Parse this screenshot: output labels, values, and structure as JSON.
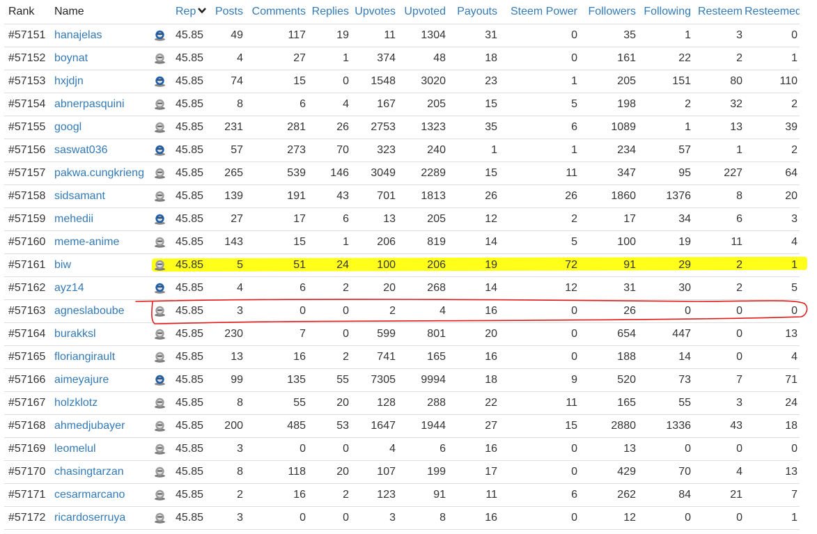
{
  "table": {
    "columns": [
      "Rank",
      "Name",
      "Rep",
      "Posts",
      "Comments",
      "Replies",
      "Upvotes",
      "Upvoted",
      "Payouts",
      "Steem Power",
      "Followers",
      "Following",
      "Resteem",
      "Resteemed"
    ],
    "sort_indicator": "chevron-down-icon",
    "rows": [
      {
        "rank": "#57151",
        "name": "hanajelas",
        "avatar": "blue-avatar-icon",
        "rep": "45.85",
        "posts": "49",
        "comments": "117",
        "replies": "19",
        "upvotes": "11",
        "upvoted": "1304",
        "payouts": "31",
        "steem_power": "0",
        "followers": "35",
        "following": "1",
        "resteem": "3",
        "resteemed": "0"
      },
      {
        "rank": "#57152",
        "name": "boynat",
        "avatar": "gray-avatar-icon",
        "rep": "45.85",
        "posts": "4",
        "comments": "27",
        "replies": "1",
        "upvotes": "374",
        "upvoted": "48",
        "payouts": "18",
        "steem_power": "0",
        "followers": "161",
        "following": "22",
        "resteem": "2",
        "resteemed": "1"
      },
      {
        "rank": "#57153",
        "name": "hxjdjn",
        "avatar": "blue-avatar-icon",
        "rep": "45.85",
        "posts": "74",
        "comments": "15",
        "replies": "0",
        "upvotes": "1548",
        "upvoted": "3020",
        "payouts": "23",
        "steem_power": "1",
        "followers": "205",
        "following": "151",
        "resteem": "80",
        "resteemed": "110"
      },
      {
        "rank": "#57154",
        "name": "abnerpasquini",
        "avatar": "gray-avatar-icon",
        "rep": "45.85",
        "posts": "8",
        "comments": "6",
        "replies": "4",
        "upvotes": "167",
        "upvoted": "205",
        "payouts": "15",
        "steem_power": "5",
        "followers": "198",
        "following": "2",
        "resteem": "32",
        "resteemed": "2"
      },
      {
        "rank": "#57155",
        "name": "googl",
        "avatar": "gray-avatar-icon",
        "rep": "45.85",
        "posts": "231",
        "comments": "281",
        "replies": "26",
        "upvotes": "2753",
        "upvoted": "1323",
        "payouts": "35",
        "steem_power": "6",
        "followers": "1089",
        "following": "1",
        "resteem": "13",
        "resteemed": "39"
      },
      {
        "rank": "#57156",
        "name": "saswat036",
        "avatar": "blue-avatar-icon",
        "rep": "45.85",
        "posts": "57",
        "comments": "273",
        "replies": "70",
        "upvotes": "323",
        "upvoted": "240",
        "payouts": "1",
        "steem_power": "1",
        "followers": "234",
        "following": "57",
        "resteem": "1",
        "resteemed": "2"
      },
      {
        "rank": "#57157",
        "name": "pakwa.cungkrieng",
        "avatar": "gray-avatar-icon",
        "rep": "45.85",
        "posts": "265",
        "comments": "539",
        "replies": "146",
        "upvotes": "3049",
        "upvoted": "2289",
        "payouts": "15",
        "steem_power": "11",
        "followers": "347",
        "following": "95",
        "resteem": "227",
        "resteemed": "64"
      },
      {
        "rank": "#57158",
        "name": "sidsamant",
        "avatar": "gray-avatar-icon",
        "rep": "45.85",
        "posts": "139",
        "comments": "191",
        "replies": "43",
        "upvotes": "701",
        "upvoted": "1813",
        "payouts": "26",
        "steem_power": "26",
        "followers": "1860",
        "following": "1376",
        "resteem": "8",
        "resteemed": "20"
      },
      {
        "rank": "#57159",
        "name": "mehedii",
        "avatar": "blue-avatar-icon",
        "rep": "45.85",
        "posts": "27",
        "comments": "17",
        "replies": "6",
        "upvotes": "13",
        "upvoted": "205",
        "payouts": "12",
        "steem_power": "2",
        "followers": "17",
        "following": "34",
        "resteem": "6",
        "resteemed": "3"
      },
      {
        "rank": "#57160",
        "name": "meme-anime",
        "avatar": "gray-avatar-icon",
        "rep": "45.85",
        "posts": "143",
        "comments": "15",
        "replies": "1",
        "upvotes": "206",
        "upvoted": "819",
        "payouts": "14",
        "steem_power": "5",
        "followers": "100",
        "following": "19",
        "resteem": "11",
        "resteemed": "4"
      },
      {
        "rank": "#57161",
        "name": "biw",
        "avatar": "gray-avatar-icon",
        "rep": "45.85",
        "posts": "5",
        "comments": "51",
        "replies": "24",
        "upvotes": "100",
        "upvoted": "206",
        "payouts": "19",
        "steem_power": "72",
        "followers": "91",
        "following": "29",
        "resteem": "2",
        "resteemed": "1"
      },
      {
        "rank": "#57162",
        "name": "ayz14",
        "avatar": "blue-avatar-icon",
        "rep": "45.85",
        "posts": "4",
        "comments": "6",
        "replies": "2",
        "upvotes": "20",
        "upvoted": "268",
        "payouts": "14",
        "steem_power": "12",
        "followers": "31",
        "following": "30",
        "resteem": "2",
        "resteemed": "5"
      },
      {
        "rank": "#57163",
        "name": "agneslaboube",
        "avatar": "gray-avatar-icon",
        "rep": "45.85",
        "posts": "3",
        "comments": "0",
        "replies": "0",
        "upvotes": "2",
        "upvoted": "4",
        "payouts": "16",
        "steem_power": "0",
        "followers": "26",
        "following": "0",
        "resteem": "0",
        "resteemed": "0"
      },
      {
        "rank": "#57164",
        "name": "burakksl",
        "avatar": "gray-avatar-icon",
        "rep": "45.85",
        "posts": "230",
        "comments": "7",
        "replies": "0",
        "upvotes": "599",
        "upvoted": "801",
        "payouts": "20",
        "steem_power": "0",
        "followers": "654",
        "following": "447",
        "resteem": "0",
        "resteemed": "13"
      },
      {
        "rank": "#57165",
        "name": "floriangirault",
        "avatar": "gray-avatar-icon",
        "rep": "45.85",
        "posts": "13",
        "comments": "16",
        "replies": "2",
        "upvotes": "741",
        "upvoted": "165",
        "payouts": "16",
        "steem_power": "0",
        "followers": "188",
        "following": "14",
        "resteem": "0",
        "resteemed": "4"
      },
      {
        "rank": "#57166",
        "name": "aimeyajure",
        "avatar": "blue-avatar-icon",
        "rep": "45.85",
        "posts": "99",
        "comments": "135",
        "replies": "55",
        "upvotes": "7305",
        "upvoted": "9994",
        "payouts": "18",
        "steem_power": "9",
        "followers": "520",
        "following": "73",
        "resteem": "7",
        "resteemed": "71"
      },
      {
        "rank": "#57167",
        "name": "holzklotz",
        "avatar": "gray-avatar-icon",
        "rep": "45.85",
        "posts": "8",
        "comments": "55",
        "replies": "20",
        "upvotes": "128",
        "upvoted": "288",
        "payouts": "22",
        "steem_power": "11",
        "followers": "165",
        "following": "55",
        "resteem": "3",
        "resteemed": "24"
      },
      {
        "rank": "#57168",
        "name": "ahmedjubayer",
        "avatar": "gray-avatar-icon",
        "rep": "45.85",
        "posts": "200",
        "comments": "485",
        "replies": "53",
        "upvotes": "1647",
        "upvoted": "1944",
        "payouts": "27",
        "steem_power": "15",
        "followers": "2880",
        "following": "1336",
        "resteem": "43",
        "resteemed": "18"
      },
      {
        "rank": "#57169",
        "name": "leomelul",
        "avatar": "gray-avatar-icon",
        "rep": "45.85",
        "posts": "3",
        "comments": "0",
        "replies": "0",
        "upvotes": "4",
        "upvoted": "6",
        "payouts": "16",
        "steem_power": "0",
        "followers": "13",
        "following": "0",
        "resteem": "0",
        "resteemed": "0"
      },
      {
        "rank": "#57170",
        "name": "chasingtarzan",
        "avatar": "gray-avatar-icon",
        "rep": "45.85",
        "posts": "8",
        "comments": "118",
        "replies": "20",
        "upvotes": "107",
        "upvoted": "199",
        "payouts": "17",
        "steem_power": "0",
        "followers": "429",
        "following": "70",
        "resteem": "4",
        "resteemed": "13"
      },
      {
        "rank": "#57171",
        "name": "cesarmarcano",
        "avatar": "gray-avatar-icon",
        "rep": "45.85",
        "posts": "2",
        "comments": "16",
        "replies": "2",
        "upvotes": "123",
        "upvoted": "91",
        "payouts": "11",
        "steem_power": "6",
        "followers": "262",
        "following": "84",
        "resteem": "21",
        "resteemed": "7"
      },
      {
        "rank": "#57172",
        "name": "ricardoserruya",
        "avatar": "gray-avatar-icon",
        "rep": "45.85",
        "posts": "3",
        "comments": "0",
        "replies": "0",
        "upvotes": "3",
        "upvoted": "8",
        "payouts": "16",
        "steem_power": "0",
        "followers": "12",
        "following": "0",
        "resteem": "0",
        "resteemed": "1"
      }
    ]
  },
  "annotations": {
    "highlight_color": "#ffff1a",
    "circle_color": "#e21b1b"
  },
  "colors": {
    "link": "#337ab7",
    "text": "#333333",
    "border": "#dddddd"
  }
}
